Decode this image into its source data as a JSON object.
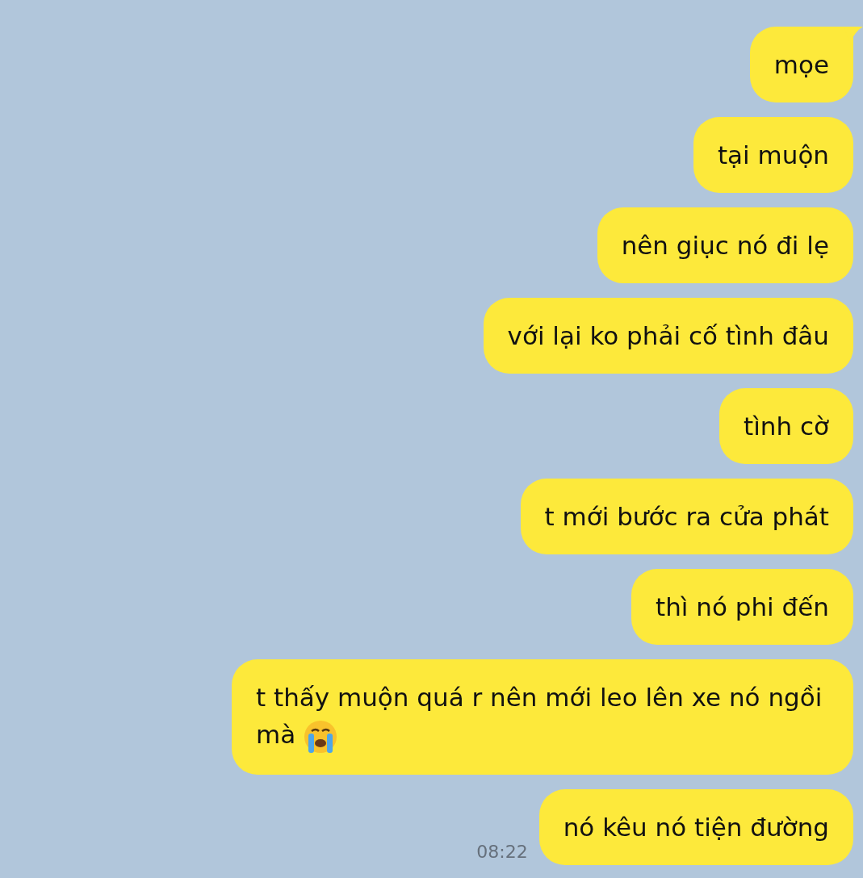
{
  "messages": [
    {
      "text": "mọe",
      "tail": true,
      "emoji": false
    },
    {
      "text": "tại muộn",
      "tail": false,
      "emoji": false
    },
    {
      "text": "nên giục nó đi lẹ",
      "tail": false,
      "emoji": false
    },
    {
      "text": "với lại ko phải cố tình đâu",
      "tail": false,
      "emoji": false
    },
    {
      "text": "tình cờ",
      "tail": false,
      "emoji": false
    },
    {
      "text": "t mới bước ra cửa phát",
      "tail": false,
      "emoji": false
    },
    {
      "text": "thì nó phi đến",
      "tail": false,
      "emoji": false
    },
    {
      "text": "t thấy muộn quá r nên mới leo lên xe nó ngồi mà",
      "tail": false,
      "emoji": true
    },
    {
      "text": "nó kêu nó tiện đường",
      "tail": false,
      "emoji": false,
      "time": "08:22"
    }
  ]
}
